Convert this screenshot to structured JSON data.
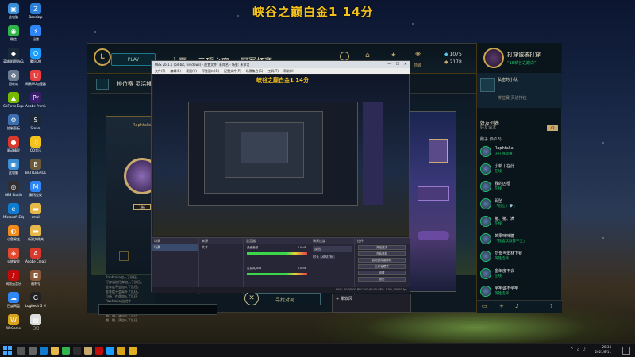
{
  "overlay_title": "峡谷之巅白金1 14分",
  "desktop_icons": [
    {
      "label": "此电脑",
      "icon": "computer-icon",
      "color": "#3b8ed6",
      "glyph": "▣"
    },
    {
      "label": "微信",
      "icon": "wechat-icon",
      "color": "#2fb54a",
      "glyph": "◉"
    },
    {
      "label": "英雄联盟WeGame版",
      "icon": "lol-icon",
      "color": "#1b2a3a",
      "glyph": "◆"
    },
    {
      "label": "回收站",
      "icon": "recycle-bin-icon",
      "color": "#6b7b8f",
      "glyph": "♻"
    },
    {
      "label": "GeForce Experience",
      "icon": "nvidia-icon",
      "color": "#76b900",
      "glyph": "▲"
    },
    {
      "label": "控制面板",
      "icon": "control-panel-icon",
      "color": "#3b6fb0",
      "glyph": "⚙"
    },
    {
      "label": "驱动精灵",
      "icon": "driver-icon",
      "color": "#d9392c",
      "glyph": "●"
    },
    {
      "label": "此电脑",
      "icon": "pc-icon",
      "color": "#3b8ed6",
      "glyph": "▣"
    },
    {
      "label": "OBS Studio",
      "icon": "obs-icon",
      "color": "#302e31",
      "glyph": "◎"
    },
    {
      "label": "Microsoft Edge",
      "icon": "edge-icon",
      "color": "#0f7ccf",
      "glyph": "e"
    },
    {
      "label": "小鱼易连",
      "icon": "meeting-icon",
      "color": "#f28a1c",
      "glyph": "◐"
    },
    {
      "label": "火绒安全",
      "icon": "security-icon",
      "color": "#e24a2f",
      "glyph": "◈"
    },
    {
      "label": "网易云音乐",
      "icon": "music-icon",
      "color": "#c20c0c",
      "glyph": "♪"
    },
    {
      "label": "百度网盘",
      "icon": "baidu-icon",
      "color": "#2f86f6",
      "glyph": "☁"
    },
    {
      "label": "WeGame",
      "icon": "wegame-icon",
      "color": "#d9a21b",
      "glyph": "W"
    },
    {
      "label": "Bandizip",
      "icon": "bandizip-icon",
      "color": "#2b7fd6",
      "glyph": "Z"
    },
    {
      "label": "迅雷",
      "icon": "thunder-icon",
      "color": "#2f86f6",
      "glyph": "⚡"
    },
    {
      "label": "腾讯QQ",
      "icon": "qq-icon",
      "color": "#1b9cff",
      "glyph": "Q"
    },
    {
      "label": "网易UU加速器",
      "icon": "uu-icon",
      "color": "#e84040",
      "glyph": "U"
    },
    {
      "label": "Adobe Premiere",
      "icon": "premiere-icon",
      "color": "#3a1d6b",
      "glyph": "Pr"
    },
    {
      "label": "Steam",
      "icon": "steam-icon",
      "color": "#1b2838",
      "glyph": "S"
    },
    {
      "label": "QQ音乐",
      "icon": "qqmusic-icon",
      "color": "#f5c21b",
      "glyph": "♫"
    },
    {
      "label": "BATTLEGROUNDS",
      "icon": "pubg-icon",
      "color": "#6a5a3a",
      "glyph": "B"
    },
    {
      "label": "腾讯会议",
      "icon": "tencent-meeting-icon",
      "color": "#2f86f6",
      "glyph": "M"
    },
    {
      "label": "email",
      "icon": "folder-icon",
      "color": "#e6b84a",
      "glyph": "▬"
    },
    {
      "label": "新建文件夹",
      "icon": "new-folder-icon",
      "color": "#e6b84a",
      "glyph": "▬"
    },
    {
      "label": "Adobe Creative",
      "icon": "adobe-icon",
      "color": "#d9392c",
      "glyph": "A"
    },
    {
      "label": "福利号",
      "icon": "gift-icon",
      "color": "#8a5a3a",
      "glyph": "◘"
    },
    {
      "label": "Logitech G HUB",
      "icon": "logitech-icon",
      "color": "#222",
      "glyph": "G"
    },
    {
      "label": "日记",
      "icon": "document-icon",
      "color": "#ddd",
      "glyph": "▤"
    }
  ],
  "client": {
    "play_label": "PLAY",
    "nav": [
      "主页",
      "云顶之弈",
      "冠军杯赛"
    ],
    "store_label": "商城",
    "blue_essence": "1075",
    "riot_points": "2178",
    "summoner_name": "打穿诚被打穿",
    "summoner_status": "“18峡谷之巅白”",
    "lobby_title": "排位赛 灵活排位",
    "player_name": "Raphtalia",
    "player_level": "196",
    "chat_lines": [
      "Raphtalia加入了队伍。",
      "打穿诚被打穿加入了队伍。",
      "金年度不会加入了队伍。",
      "金年度不会离开了队伍。",
      "小新「在此加入了队伍",
      "Raphtalia 自进中",
      "金年度不会离开了队伍",
      "小新「在此加入了队伍",
      "懒、懒，满加入了队伍",
      "懒、懒，满加入了队伍"
    ],
    "find_match_label": "寻找对局",
    "close_symbol": "✕"
  },
  "social": {
    "club_title": "私密的小队",
    "club_sub": "排位赛 灵活排位",
    "friends_header": "好友列表",
    "friend_requests": "好友请求",
    "request_count": "42",
    "group_label": "鹅子 (9/18)",
    "friends": [
      {
        "name": "Raphtalia",
        "status": "正在挑战赛"
      },
      {
        "name": "小新丨在此",
        "status": "在线"
      },
      {
        "name": "我的凶框",
        "status": "在线"
      },
      {
        "name": "明坠",
        "status": "「别吐丿💎」"
      },
      {
        "name": "猪、猪、满",
        "status": "在线"
      },
      {
        "name": "芒果咪咪糖",
        "status": "「我喜欢敌猝干宝」"
      },
      {
        "name": "勿负当年林下赛",
        "status": "英雄选择"
      },
      {
        "name": "金年度不会",
        "status": "在线"
      },
      {
        "name": "坐牢诚不坐牢",
        "status": "英雄选择"
      }
    ]
  },
  "obs": {
    "title": "OBS 26.1.1 (64-bit, windows) - 配置文件: 未命名 - 场景: 未命名",
    "menu": [
      "文件(F)",
      "编辑(E)",
      "视图(V)",
      "停靠窗口(D)",
      "配置文件(P)",
      "场景集合(S)",
      "工具(T)",
      "帮助(H)"
    ],
    "preview_title": "峡谷之巅白金1 14分",
    "docks": [
      "场景",
      "来源",
      "混音器",
      "场景过渡",
      "控件"
    ],
    "scene_item": "场景",
    "source_item": "文本",
    "mixer_channels": [
      "桌面音频",
      "麦克风/Aux"
    ],
    "mixer_db": [
      "0.0 dB",
      "0.0 dB"
    ],
    "transition": "淡出",
    "duration_label": "时长",
    "duration": "300 ms",
    "controls": [
      "开始推流",
      "开始录制",
      "启动虚拟摄像机",
      "工作室模式",
      "设置",
      "退出"
    ],
    "status": "LIVE: 00:00:00  REC: 00:00:00  CPU: 1.5%, 30.00 fps",
    "popup_item": "柔软风"
  },
  "taskbar": {
    "time": "20:34",
    "date": "2021/8/11",
    "apps": [
      {
        "icon": "search-icon",
        "color": "#555"
      },
      {
        "icon": "task-view-icon",
        "color": "#666"
      },
      {
        "icon": "edge-icon",
        "color": "#0f7ccf"
      },
      {
        "icon": "file-explorer-icon",
        "color": "#e6b84a"
      },
      {
        "icon": "wechat-icon",
        "color": "#2fb54a"
      },
      {
        "icon": "obs-icon",
        "color": "#302e31"
      },
      {
        "icon": "lol-icon",
        "color": "#c8aa6e"
      },
      {
        "icon": "netease-music-icon",
        "color": "#c20c0c"
      },
      {
        "icon": "qq-icon",
        "color": "#1b9cff"
      },
      {
        "icon": "wegame-icon",
        "color": "#d9a21b"
      },
      {
        "icon": "chrome-icon",
        "color": "#e0b020"
      }
    ]
  }
}
